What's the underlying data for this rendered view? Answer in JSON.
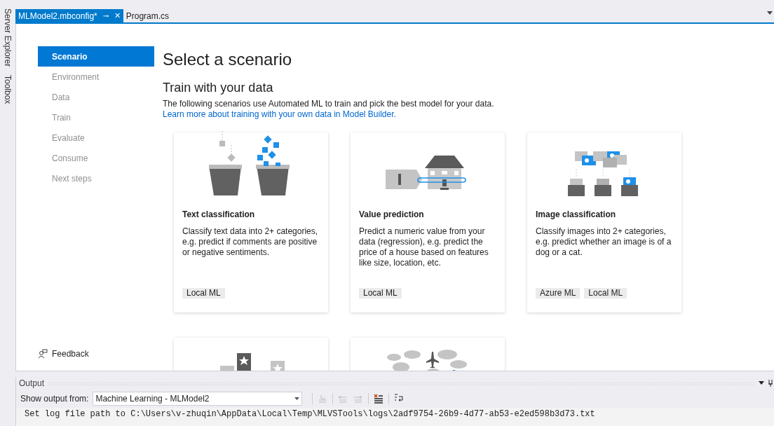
{
  "side_panel": [
    {
      "label": "Server Explorer"
    },
    {
      "label": "Toolbox"
    }
  ],
  "tabs": [
    {
      "label": "MLModel2.mbconfig*",
      "selected": true,
      "pin": "⊸",
      "close": "✕"
    },
    {
      "label": "Program.cs",
      "selected": false
    }
  ],
  "steps": [
    {
      "label": "Scenario",
      "selected": true
    },
    {
      "label": "Environment",
      "selected": false
    },
    {
      "label": "Data",
      "selected": false
    },
    {
      "label": "Train",
      "selected": false
    },
    {
      "label": "Evaluate",
      "selected": false
    },
    {
      "label": "Consume",
      "selected": false
    },
    {
      "label": "Next steps",
      "selected": false
    }
  ],
  "feedback": "Feedback",
  "title": "Select a scenario",
  "section": {
    "heading": "Train with your data",
    "description": "The following scenarios use Automated ML to train and pick the best model for your data.",
    "link": "Learn more about training with your own data in Model Builder."
  },
  "scenarios": [
    {
      "kind": "buckets",
      "title": "Text classification",
      "description": "Classify text data into 2+ categories, e.g. predict if comments are positive or negative sentiments.",
      "tags": [
        "Local ML"
      ]
    },
    {
      "kind": "house",
      "title": "Value prediction",
      "description": "Predict a numeric value from your data (regression), e.g. predict the price of a house based on features like size, location, etc.",
      "tags": [
        "Local ML"
      ]
    },
    {
      "kind": "folders",
      "title": "Image classification",
      "description": "Classify images into 2+ categories, e.g. predict whether an image is of a dog or a cat.",
      "tags": [
        "Azure ML",
        "Local ML"
      ]
    },
    {
      "kind": "stars"
    },
    {
      "kind": "weather"
    }
  ],
  "output": {
    "title": "Output",
    "source_label": "Show output from:",
    "source_value": "Machine Learning - MLModel2",
    "log": "Set log file path to C:\\Users\\v-zhuqin\\AppData\\Local\\Temp\\MLVSTools\\logs\\2adf9754-26b9-4d77-ab53-e2ed598b3d73.txt"
  }
}
